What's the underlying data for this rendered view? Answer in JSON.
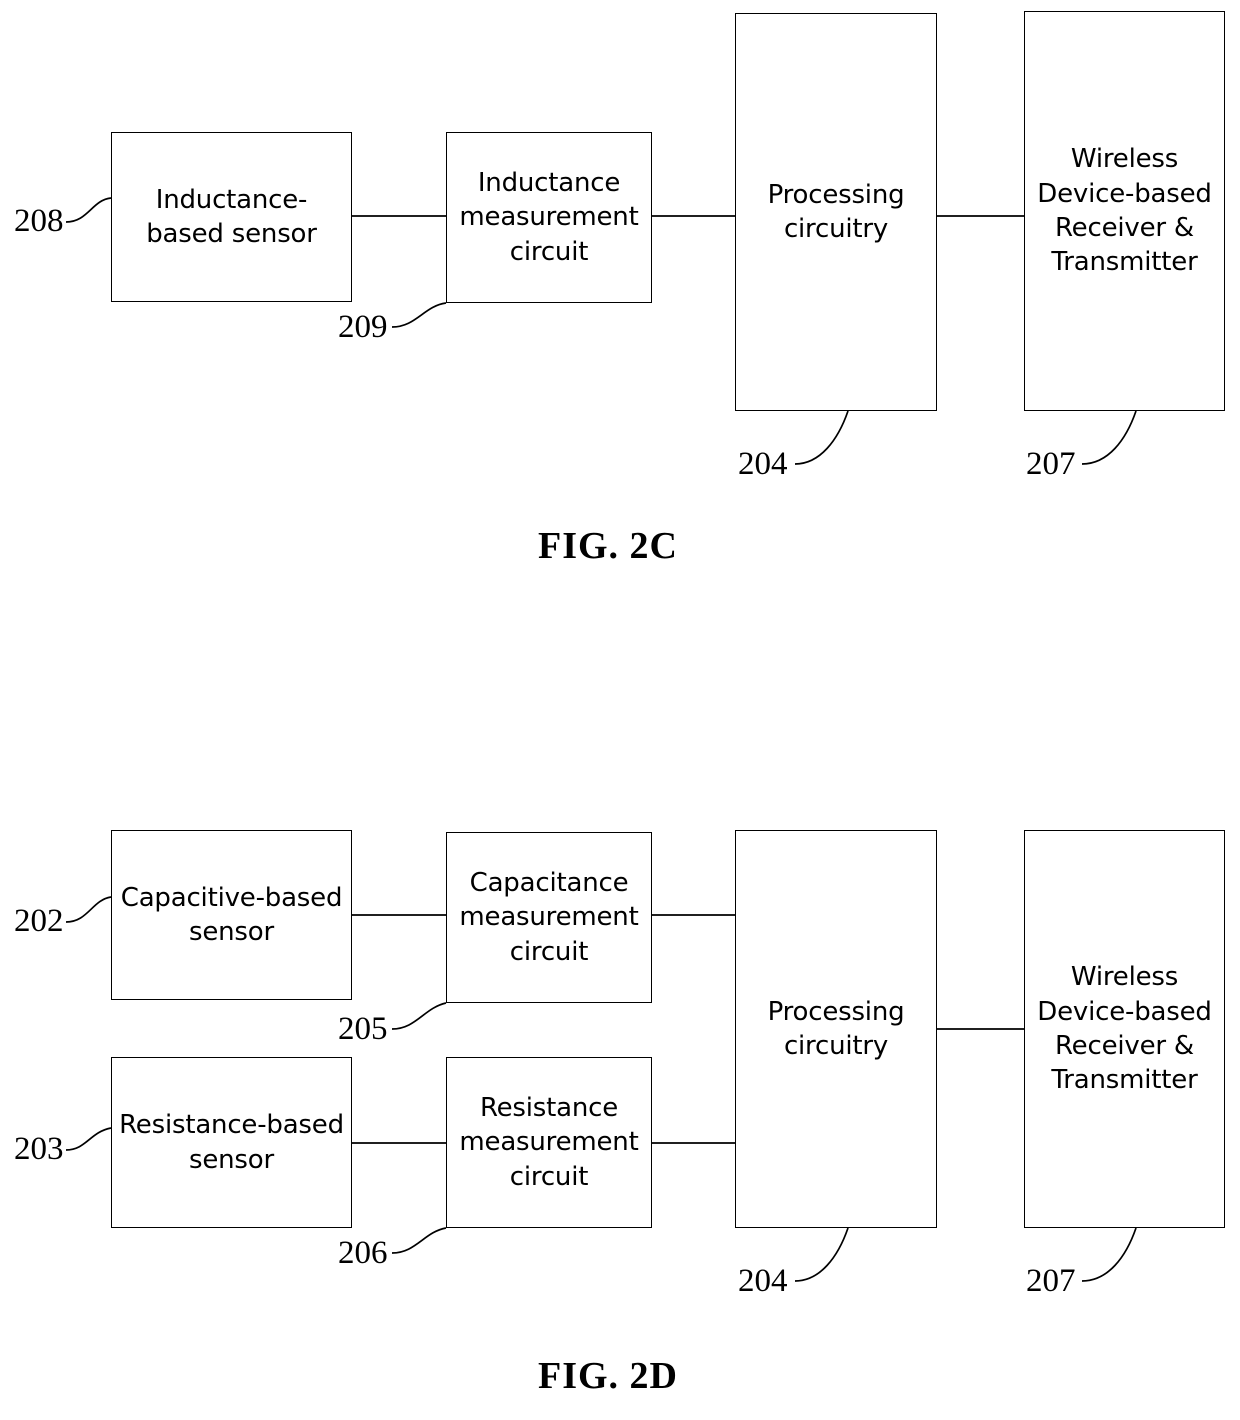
{
  "document": {
    "type": "patent-figure-sheet",
    "sheet_width": 1240,
    "sheet_height": 1420,
    "background_color": "#ffffff",
    "line_color": "#000000"
  },
  "figures": [
    {
      "id": "fig-2c",
      "caption": "FIG. 2C",
      "blocks": {
        "sensor": {
          "label": "Inductance-\nbased sensor",
          "ref": "208"
        },
        "measurement": {
          "label": "Inductance\nmeasurement\ncircuit",
          "ref": "209"
        },
        "processing": {
          "label": "Processing\ncircuitry",
          "ref": "204"
        },
        "wireless": {
          "label": "Wireless\nDevice-based\nReceiver &\nTransmitter",
          "ref": "207"
        }
      }
    },
    {
      "id": "fig-2d",
      "caption": "FIG. 2D",
      "blocks": {
        "capacitive_sensor": {
          "label": "Capacitive-based\nsensor",
          "ref": "202"
        },
        "capacitance_measurement": {
          "label": "Capacitance\nmeasurement\ncircuit",
          "ref": "205"
        },
        "resistance_sensor": {
          "label": "Resistance-based\nsensor",
          "ref": "203"
        },
        "resistance_measurement": {
          "label": "Resistance\nmeasurement\ncircuit",
          "ref": "206"
        },
        "processing": {
          "label": "Processing\ncircuitry",
          "ref": "204"
        },
        "wireless": {
          "label": "Wireless\nDevice-based\nReceiver &\nTransmitter",
          "ref": "207"
        }
      }
    }
  ]
}
